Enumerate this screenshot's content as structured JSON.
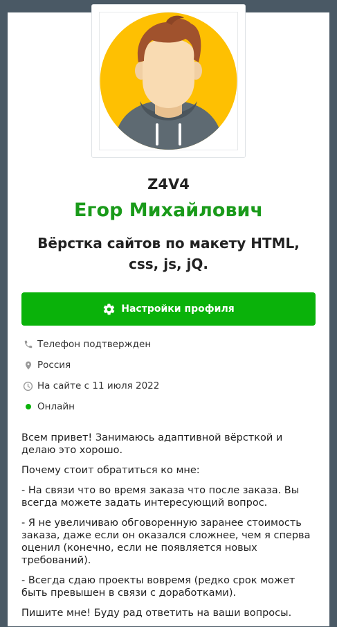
{
  "profile": {
    "username": "Z4V4",
    "full_name": "Егор Михайлович",
    "specialization": "Вёрстка сайтов по макету HTML, css, js, jQ."
  },
  "actions": {
    "settings_label": "Настройки профиля"
  },
  "info": {
    "phone": "Телефон подтвержден",
    "country": "Россия",
    "member_since": "На сайте с 11 июля 2022",
    "status": "Онлайн"
  },
  "about": {
    "p1": "Всем привет! Занимаюсь адаптивной вёрсткой и делаю это хорошо.",
    "p2": "Почему стоит обратиться ко мне:",
    "p3": "- На связи что во время заказа что после заказа. Вы всегда можете задать интересующий вопрос.",
    "p4": "- Я не увеличиваю обговоренную заранее стоимость заказа, даже если он оказался сложнее, чем я сперва оценил (конечно, если не появляется новых требований).",
    "p5": "- Всегда сдаю проекты вовремя (редко срок может быть превышен в связи с доработками).",
    "p6": "Пишите мне! Буду рад ответить на ваши вопросы."
  },
  "colors": {
    "brand_green": "#0ab20a",
    "name_green": "#1a9a1a",
    "online_dot": "#0ab20a",
    "avatar_bg": "#fec002"
  },
  "icons": {
    "settings": "gear-icon",
    "phone": "phone-icon",
    "country": "location-pin-icon",
    "member_since": "clock-icon",
    "status": "online-dot-icon"
  }
}
